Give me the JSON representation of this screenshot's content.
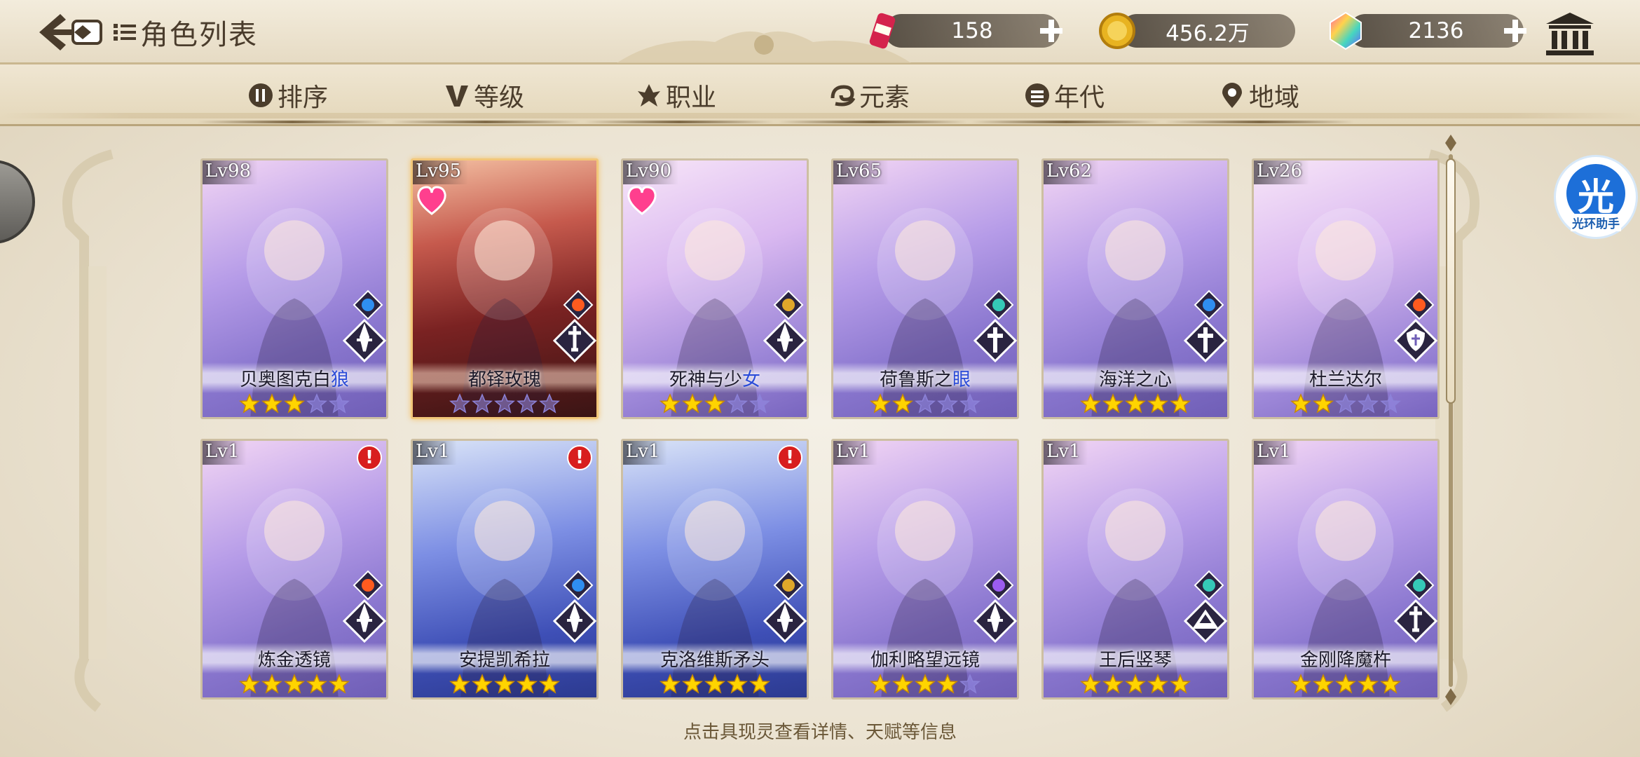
{
  "header": {
    "title": "角色列表",
    "back_icon": "back-arrow-icon",
    "list_icon": "list-icon"
  },
  "resources": [
    {
      "id": "stamina",
      "icon": "soda-can-icon",
      "value": "158"
    },
    {
      "id": "gold",
      "icon": "gold-coin-icon",
      "value": "456.2万"
    },
    {
      "id": "gem",
      "icon": "rainbow-gem-icon",
      "value": "2136"
    }
  ],
  "filters": [
    {
      "label": "排序",
      "icon": "sort-icon"
    },
    {
      "label": "等级",
      "icon": "level-v-icon"
    },
    {
      "label": "职业",
      "icon": "class-icon"
    },
    {
      "label": "元素",
      "icon": "element-swirl-icon"
    },
    {
      "label": "年代",
      "icon": "era-icon"
    },
    {
      "label": "地域",
      "icon": "location-pin-icon"
    }
  ],
  "assist": {
    "big": "光",
    "small": "光环助手"
  },
  "colors": {
    "accent": "#8a77cf",
    "star": "#ffd400",
    "fire": "#ff5b1f",
    "water": "#2f8ef0",
    "earth": "#e0a72a",
    "wind": "#35c9b7"
  },
  "cards": [
    {
      "level": "Lv98",
      "name": "贝奥图克白",
      "name_hl": "狼",
      "stars": 3,
      "element": "water",
      "cls": "dagger",
      "heart": false,
      "alert": false,
      "style": "purple"
    },
    {
      "level": "Lv95",
      "name": "都铎玫瑰",
      "name_hl": "",
      "stars": 0,
      "element": "fire",
      "cls": "sword",
      "heart": true,
      "alert": false,
      "style": "red"
    },
    {
      "level": "Lv90",
      "name": "死神与少",
      "name_hl": "女",
      "stars": 3,
      "element": "earth",
      "cls": "dagger",
      "heart": true,
      "alert": false,
      "style": "soft"
    },
    {
      "level": "Lv65",
      "name": "荷鲁斯之",
      "name_hl": "眼",
      "stars": 2,
      "element": "wind",
      "cls": "cross",
      "heart": false,
      "alert": false,
      "style": "purple"
    },
    {
      "level": "Lv62",
      "name": "海洋之心",
      "name_hl": "",
      "stars": 5,
      "element": "water",
      "cls": "cross",
      "heart": false,
      "alert": false,
      "style": "purple"
    },
    {
      "level": "Lv26",
      "name": "杜兰达尔",
      "name_hl": "",
      "stars": 2,
      "element": "fire",
      "cls": "shield",
      "heart": false,
      "alert": false,
      "style": "soft"
    },
    {
      "level": "Lv1",
      "name": "炼金透镜",
      "name_hl": "",
      "stars": 5,
      "element": "fire",
      "cls": "dagger",
      "heart": false,
      "alert": true,
      "style": "purple"
    },
    {
      "level": "Lv1",
      "name": "安提凯希拉",
      "name_hl": "",
      "stars": 5,
      "element": "water",
      "cls": "dagger",
      "heart": false,
      "alert": true,
      "style": "blue"
    },
    {
      "level": "Lv1",
      "name": "克洛维斯矛头",
      "name_hl": "",
      "stars": 5,
      "element": "earth",
      "cls": "dagger",
      "heart": false,
      "alert": true,
      "style": "blue"
    },
    {
      "level": "Lv1",
      "name": "伽利略望远镜",
      "name_hl": "",
      "stars": 4,
      "element": "thunder",
      "cls": "dagger",
      "heart": false,
      "alert": false,
      "style": "purple"
    },
    {
      "level": "Lv1",
      "name": "王后竖琴",
      "name_hl": "",
      "stars": 5,
      "element": "wind",
      "cls": "book",
      "heart": false,
      "alert": false,
      "style": "purple"
    },
    {
      "level": "Lv1",
      "name": "金刚降魔杵",
      "name_hl": "",
      "stars": 5,
      "element": "wind",
      "cls": "sword",
      "heart": false,
      "alert": false,
      "style": "purple"
    }
  ],
  "hint": "点击具现灵查看详情、天赋等信息"
}
